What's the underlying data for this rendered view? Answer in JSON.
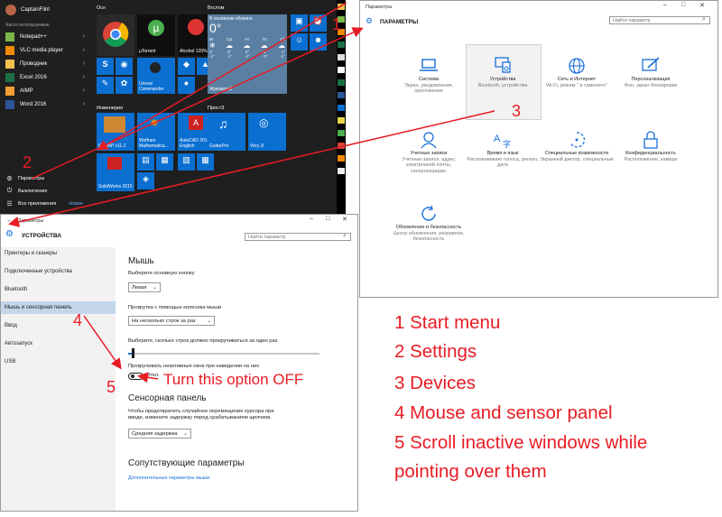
{
  "start_menu": {
    "user": "CaptainFlint",
    "most_used_header": "Часто используемые",
    "apps": [
      {
        "label": "Notepad++",
        "color": "#7ab648"
      },
      {
        "label": "VLC media player",
        "color": "#f08a00"
      },
      {
        "label": "Проводник",
        "color": "#f2c14e"
      },
      {
        "label": "Excel 2016",
        "color": "#1d7044"
      },
      {
        "label": "AIMP",
        "color": "#f0a030"
      },
      {
        "label": "Word 2016",
        "color": "#2b579a"
      }
    ],
    "settings_label": "Параметры",
    "shutdown_label": "Выключение",
    "all_apps_label": "Все приложения",
    "new_label": "Новое",
    "group_main": "Осн",
    "group_all": "Вгслом",
    "group_engineering": "Инженерия",
    "group_other": "Прост3",
    "tiles": {
      "utorrent": "µTorrent",
      "alcohol": "Alcohol 120%",
      "unreal": "Unreal Commander",
      "weather_now": "В основном облачно",
      "temp": "0°",
      "city": "Жуковский",
      "days": [
        "Вт",
        "Ср",
        "Чт",
        "Пт",
        "Сб"
      ],
      "highs": [
        "1°",
        "3°",
        "2°",
        "2°",
        "1°"
      ],
      "lows": [
        "-2°",
        "-1°",
        "-2°",
        "-3°",
        "-1°"
      ],
      "femap": "FEMAP v11.2",
      "wolfram": "Wolfram Mathematica...",
      "autocad": "AutoCAD 2016 - English",
      "guitarpro": "GuitarPro",
      "verypdf": "Verу..8",
      "solidworks": "SolidWorks 2015"
    }
  },
  "settings_main": {
    "window_title": "Параметры",
    "header": "ПАРАМЕТРЫ",
    "search_placeholder": "Найти параметр",
    "categories": [
      {
        "icon": "laptop-icon",
        "name": "Система",
        "desc": "Экран, уведомления, приложения"
      },
      {
        "icon": "devices-icon",
        "name": "Устройства",
        "desc": "Bluetooth, устройства"
      },
      {
        "icon": "globe-icon",
        "name": "Сеть и Интернет",
        "desc": "Wi-Fi, режим \" в самолете\""
      },
      {
        "icon": "personalization-icon",
        "name": "Персонализация",
        "desc": "Фон, экран блокировки"
      },
      {
        "icon": "person-icon",
        "name": "Учетные записи",
        "desc": "Учетные записи, адрес электронной почты, синхронизация,"
      },
      {
        "icon": "language-icon",
        "name": "Время и язык",
        "desc": "Распознавание голоса, регион, дата"
      },
      {
        "icon": "accessibility-icon",
        "name": "Специальные возможности",
        "desc": "Экранный диктор, специальные"
      },
      {
        "icon": "lock-icon",
        "name": "Конфиденциальность",
        "desc": "Расположение, камера"
      },
      {
        "icon": "update-icon",
        "name": "Обновление и безопасность",
        "desc": "Центр обновления, резервное, безопасность"
      }
    ]
  },
  "settings_devices": {
    "window_title": "Параметры",
    "header": "УСТРОЙСТВА",
    "search_placeholder": "Найти параметр",
    "nav": [
      "Принтеры и сканеры",
      "Подключенные устройства",
      "Bluetooth",
      "Мышь и сенсорная панель",
      "Ввод",
      "Автозапуск",
      "USB"
    ],
    "selected_nav": 3,
    "mouse_title": "Мышь",
    "primary_button_label": "Выберите основную кнопку",
    "primary_button_value": "Левая",
    "wheel_label": "Прокрутка с помощью колесика мыши",
    "wheel_value": "На несколько строк за раз",
    "lines_label": "Выберите, сколько строк должно прокручиваться за один раз",
    "inactive_label": "Прокручивать неактивные окна при наведении на них",
    "toggle_state": "Откл.",
    "touchpad_title": "Сенсорная панель",
    "touchpad_desc": "Чтобы предотвратить случайное перемещение курсора при вводе, измените задержку перед срабатыванием щелчков.",
    "touchpad_value": "Средняя задержка",
    "related_title": "Сопутствующие параметры",
    "related_link": "Дополнительные параметры мыши"
  },
  "annotations": {
    "markers": [
      "1",
      "2",
      "3",
      "4",
      "5"
    ],
    "turn_off_note": "Turn this option OFF",
    "legend": [
      "1 Start menu",
      "2 Settings",
      "3 Devices",
      "4 Mouse and sensor panel",
      "5 Scroll inactive windows while",
      "pointing over them"
    ],
    "accent": "#e81c24"
  }
}
